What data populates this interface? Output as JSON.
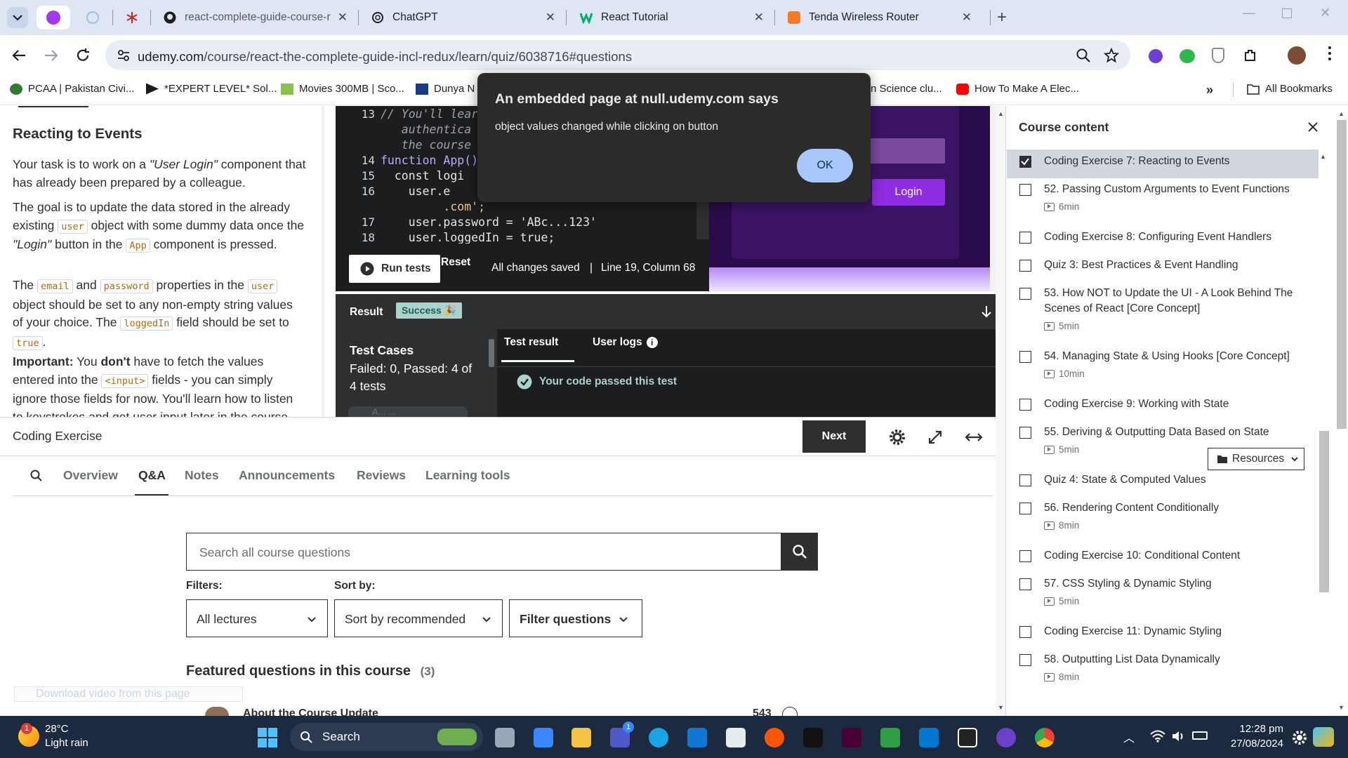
{
  "browser": {
    "tabs": [
      {
        "label": "react-complete-guide-course-r",
        "icon": "github-icon"
      },
      {
        "label": "ChatGPT",
        "icon": "openai-icon"
      },
      {
        "label": "React Tutorial",
        "icon": "w3schools-icon"
      },
      {
        "label": "Tenda Wireless Router",
        "icon": "tenda-icon"
      }
    ],
    "url_host": "udemy.com",
    "url_path": "/course/react-the-complete-guide-incl-redux/learn/quiz/6038716#questions",
    "bookmarks": [
      "PCAA | Pakistan Civi...",
      "*EXPERT LEVEL* Sol...",
      "Movies 300MB | Sco...",
      "Dunya N",
      "n Science clu...",
      "How To Make A Elec..."
    ],
    "all_bookmarks": "All Bookmarks"
  },
  "instructions": {
    "title": "Reacting to Events",
    "p1_a": "Your task is to work on a ",
    "p1_b": "\"User Login\"",
    "p1_c": " component that has already been prepared by a colleague.",
    "p2_a": "The goal is to update the data stored in the already existing ",
    "p2_code1": "user",
    "p2_b": " object with some dummy data once the ",
    "p2_c": "\"Login\"",
    "p2_d": " button in the ",
    "p2_code2": "App",
    "p2_e": " component is pressed.",
    "p3_a": "The ",
    "p3_code1": "email",
    "p3_b": " and ",
    "p3_code2": "password",
    "p3_c": " properties in the ",
    "p3_code3": "user",
    "p3_d": " object should be set to any non-empty string values of your choice. The ",
    "p3_code4": "loggedIn",
    "p3_e": " field should be set to ",
    "p3_code5": "true",
    "p3_f": ".",
    "p4_bold": "Important:",
    "p4_a": " You ",
    "p4_bold2": "don't",
    "p4_b": " have to fetch the values entered into the ",
    "p4_code": "<input>",
    "p4_c": " fields - you can simply ignore those fields for now. You'll learn how to listen to keystrokes and get user input later in the course."
  },
  "editor": {
    "lines": [
      {
        "num": "13",
        "text": "// You'll lear"
      },
      {
        "num": "",
        "text": "   authentica"
      },
      {
        "num": "",
        "text": "   the course"
      },
      {
        "num": "14",
        "text": "function App()"
      },
      {
        "num": "15",
        "text": "  const logi"
      },
      {
        "num": "16",
        "text": "    user.e"
      },
      {
        "num": "",
        "text": "         .com';"
      },
      {
        "num": "17",
        "text": "    user.password = 'ABc...123'"
      },
      {
        "num": "18",
        "text": "    user.loggedIn = true;"
      }
    ],
    "run_tests": "Run tests",
    "reset": "Reset",
    "status": "All changes saved",
    "separator": "|",
    "position": "Line 19, Column 68"
  },
  "preview": {
    "login_button": "Login"
  },
  "result": {
    "label": "Result",
    "badge": "Success 🎉",
    "test_cases_title": "Test Cases",
    "test_cases_summary": "Failed: 0, Passed: 4 of 4 tests",
    "tab_result": "Test result",
    "tab_logs": "User logs",
    "passed_message": "Your code passed this test",
    "truncated_row": "A... ..."
  },
  "bottom_bar": {
    "label": "Coding Exercise",
    "next": "Next"
  },
  "lower_nav": {
    "tabs": [
      "Overview",
      "Q&A",
      "Notes",
      "Announcements",
      "Reviews",
      "Learning tools"
    ],
    "active": "Q&A"
  },
  "qa": {
    "search_placeholder": "Search all course questions",
    "filters_label": "Filters:",
    "sort_label": "Sort by:",
    "filter_value": "All lectures",
    "sort_value": "Sort by recommended",
    "filter_questions": "Filter questions",
    "featured_title": "Featured questions in this course",
    "featured_count": "(3)",
    "download_banner": "Download video from this page",
    "question_title": "About the Course Update",
    "question_votes": "543"
  },
  "dialog": {
    "title": "An embedded page at null.udemy.com says",
    "message": "object values changed while clicking on button",
    "ok": "OK"
  },
  "sidebar": {
    "title": "Course content",
    "resources": "Resources",
    "items": [
      {
        "title": "Coding Exercise 7: Reacting to Events",
        "duration": "",
        "checked": true
      },
      {
        "title": "52. Passing Custom Arguments to Event Functions",
        "duration": "6min",
        "checked": false
      },
      {
        "title": "Coding Exercise 8: Configuring Event Handlers",
        "duration": "",
        "checked": false
      },
      {
        "title": "Quiz 3: Best Practices & Event Handling",
        "duration": "",
        "checked": false
      },
      {
        "title": "53. How NOT to Update the UI - A Look Behind The Scenes of React [Core Concept]",
        "duration": "5min",
        "checked": false
      },
      {
        "title": "54. Managing State & Using Hooks [Core Concept]",
        "duration": "10min",
        "checked": false
      },
      {
        "title": "Coding Exercise 9: Working with State",
        "duration": "",
        "checked": false
      },
      {
        "title": "55. Deriving & Outputting Data Based on State",
        "duration": "5min",
        "checked": false
      },
      {
        "title": "Quiz 4: State & Computed Values",
        "duration": "",
        "checked": false
      },
      {
        "title": "56. Rendering Content Conditionally",
        "duration": "8min",
        "checked": false
      },
      {
        "title": "Coding Exercise 10: Conditional Content",
        "duration": "",
        "checked": false
      },
      {
        "title": "57. CSS Styling & Dynamic Styling",
        "duration": "5min",
        "checked": false
      },
      {
        "title": "Coding Exercise 11: Dynamic Styling",
        "duration": "",
        "checked": false
      },
      {
        "title": "58. Outputting List Data Dynamically",
        "duration": "8min",
        "checked": false
      }
    ]
  },
  "taskbar": {
    "weather_temp": "28°C",
    "weather_desc": "Light rain",
    "weather_badge": "1",
    "search": "Search",
    "time": "12:28 pm",
    "date": "27/08/2024",
    "teams_badge": "1"
  }
}
